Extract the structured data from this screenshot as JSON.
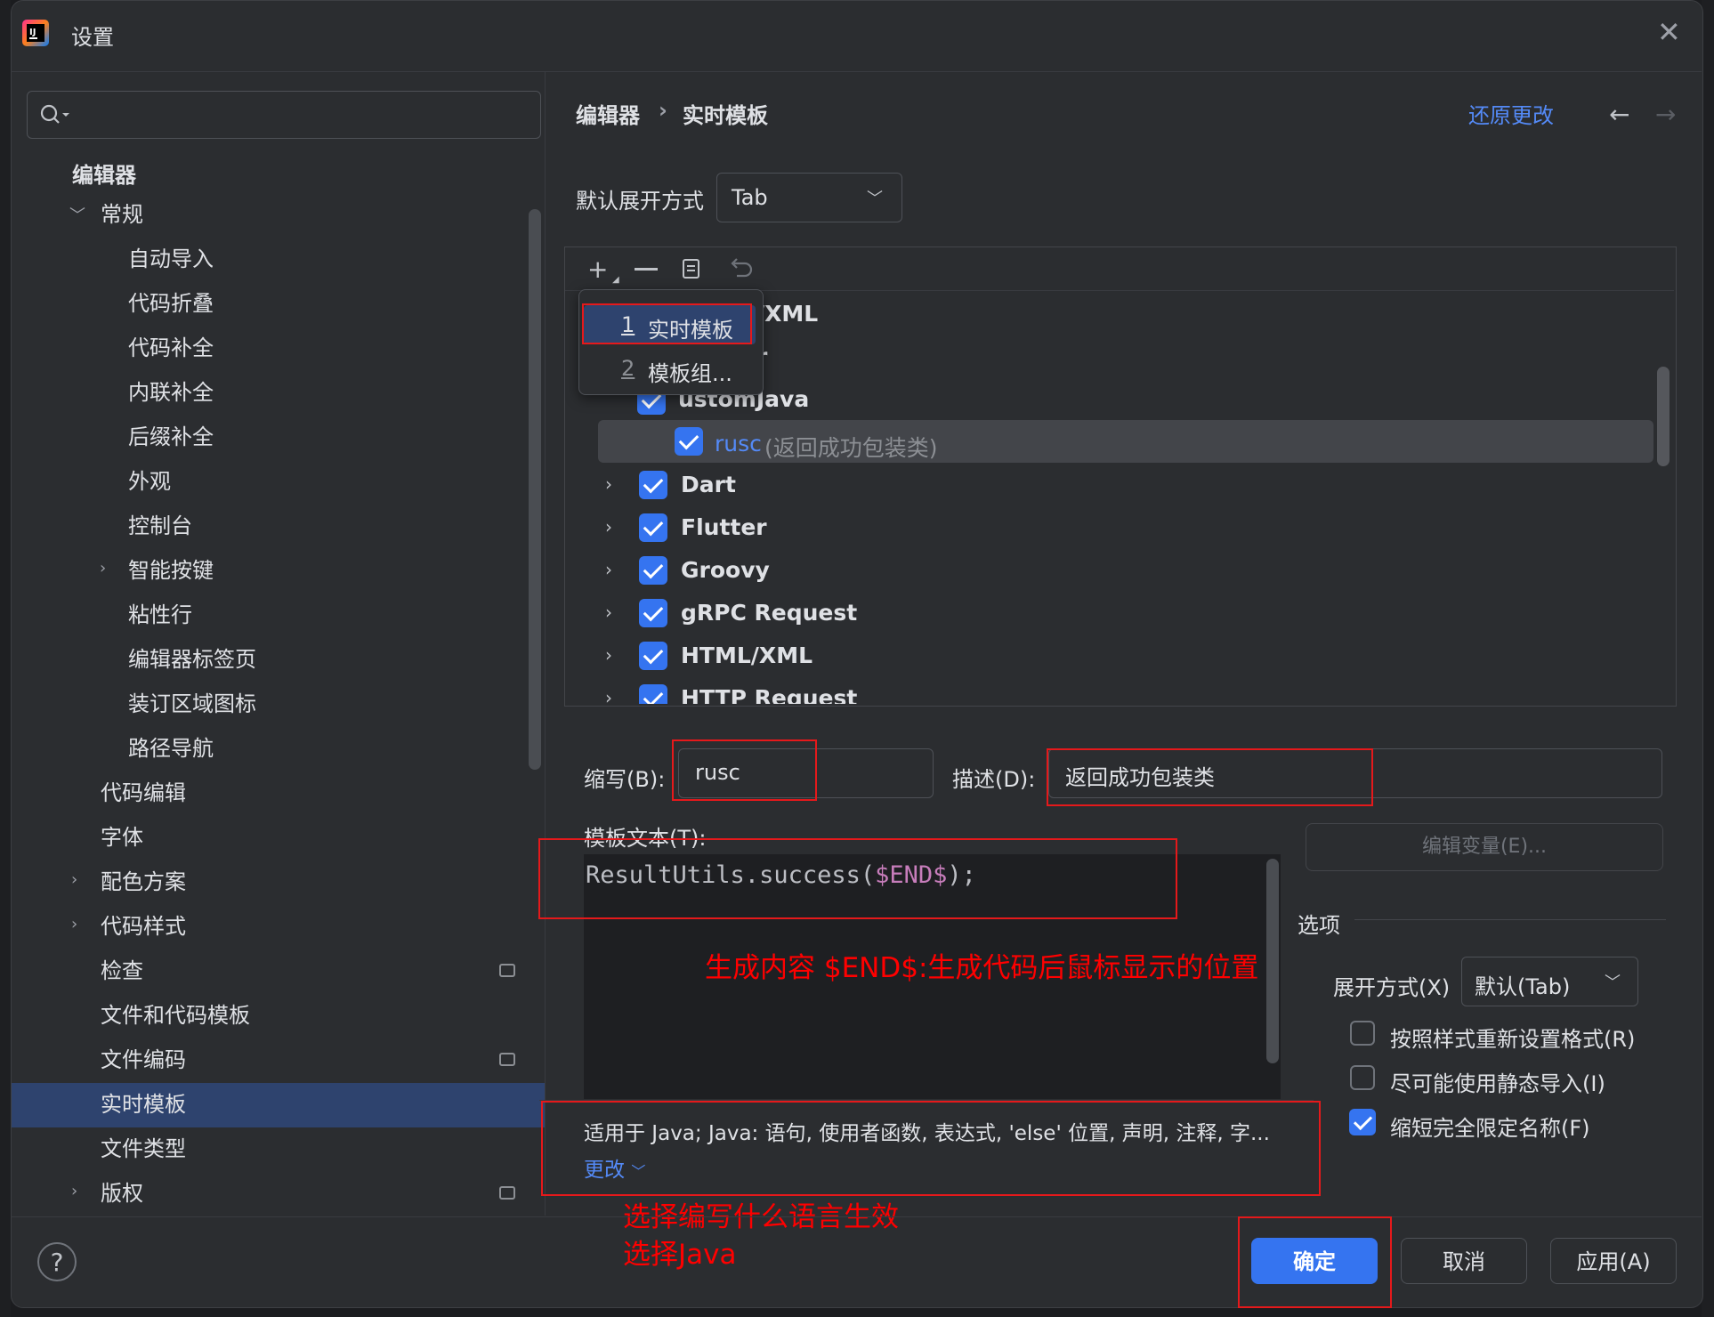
{
  "window": {
    "title": "设置",
    "close_icon": "close-icon"
  },
  "search": {
    "value": ""
  },
  "tree": {
    "section": "编辑器",
    "items": [
      {
        "label": "常规",
        "expanded": true
      },
      {
        "label": "自动导入"
      },
      {
        "label": "代码折叠"
      },
      {
        "label": "代码补全"
      },
      {
        "label": "内联补全"
      },
      {
        "label": "后缀补全"
      },
      {
        "label": "外观"
      },
      {
        "label": "控制台"
      },
      {
        "label": "智能按键"
      },
      {
        "label": "粘性行"
      },
      {
        "label": "编辑器标签页"
      },
      {
        "label": "装订区域图标"
      },
      {
        "label": "路径导航"
      },
      {
        "label": "代码编辑"
      },
      {
        "label": "字体"
      },
      {
        "label": "配色方案"
      },
      {
        "label": "代码样式"
      },
      {
        "label": "检查"
      },
      {
        "label": "文件和代码模板"
      },
      {
        "label": "文件编码"
      },
      {
        "label": "实时模板",
        "selected": true
      },
      {
        "label": "文件类型"
      },
      {
        "label": "版权"
      }
    ]
  },
  "header": {
    "crumb1": "编辑器",
    "separator": "›",
    "crumb2": "实时模板",
    "restore": "还原更改",
    "back": "←",
    "forward": "→"
  },
  "expand": {
    "label": "默认展开方式",
    "value": "Tab"
  },
  "popup": {
    "items": [
      {
        "num": "1",
        "label": "实时模板"
      },
      {
        "num": "2",
        "label": "模板组..."
      }
    ]
  },
  "templates": {
    "partial1": "/XML",
    "partial2": "r",
    "partial3": "ustomJava",
    "selected_abbr": "rusc",
    "selected_desc": "(返回成功包装类)",
    "groups": [
      "Dart",
      "Flutter",
      "Groovy",
      "gRPC Request",
      "HTML/XML",
      "HTTP Request"
    ]
  },
  "form": {
    "abbr_label": "缩写(B):",
    "abbr_value": "rusc",
    "desc_label": "描述(D):",
    "desc_value": "返回成功包装类",
    "text_label": "模板文本(T):",
    "code_prefix": "ResultUtils.success(",
    "code_var": "$END$",
    "code_suffix": ");",
    "edit_vars": "编辑变量(E)...",
    "applicable": "适用于 Java; Java: 语句, 使用者函数, 表达式, 'else' 位置, 声明, 注释, 字...",
    "change": "更改"
  },
  "options": {
    "title": "选项",
    "expand_label": "展开方式(X)",
    "expand_value": "默认(Tab)",
    "reformat": "按照样式重新设置格式(R)",
    "static_import": "尽可能使用静态导入(I)",
    "shorten_fq": "缩短完全限定名称(F)",
    "reformat_checked": false,
    "static_checked": false,
    "shorten_checked": true
  },
  "annotations": {
    "note1": "生成内容 $END$:生成代码后鼠标显示的位置",
    "note2": "选择编写什么语言生效",
    "note3": "选择Java"
  },
  "buttons": {
    "ok": "确定",
    "cancel": "取消",
    "apply": "应用(A)",
    "help": "?"
  },
  "colors": {
    "accent": "#3574f0",
    "link": "#548af7",
    "annotation": "#e5191b",
    "selected_row": "#2e436e"
  }
}
